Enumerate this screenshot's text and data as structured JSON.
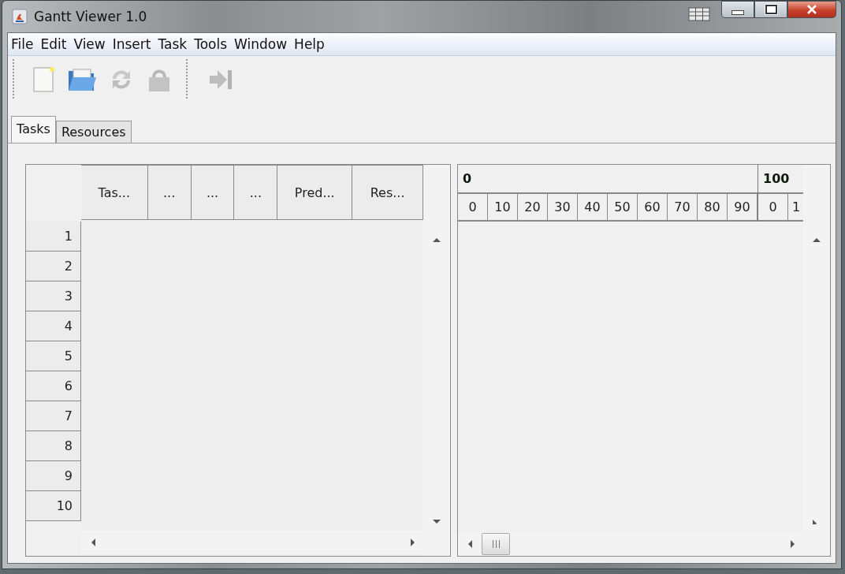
{
  "window": {
    "title": "Gantt Viewer 1.0"
  },
  "menu": [
    "File",
    "Edit",
    "View",
    "Insert",
    "Task",
    "Tools",
    "Window",
    "Help"
  ],
  "toolbar": [
    {
      "kind": "new",
      "disabled": false
    },
    {
      "kind": "open",
      "disabled": false
    },
    {
      "kind": "refresh",
      "disabled": true
    },
    {
      "kind": "save",
      "disabled": true
    },
    {
      "kind": "separator"
    },
    {
      "kind": "exit",
      "disabled": true
    }
  ],
  "tabs": [
    {
      "label": "Tasks",
      "selected": true
    },
    {
      "label": "Resources",
      "selected": false
    }
  ],
  "task_table": {
    "columns": [
      "Tas...",
      "...",
      "...",
      "...",
      "Pred...",
      "Res..."
    ],
    "row_numbers": [
      "1",
      "2",
      "3",
      "4",
      "5",
      "6",
      "7",
      "8",
      "9",
      "10"
    ]
  },
  "timeline": {
    "periods": [
      {
        "label": "0",
        "ticks": [
          "0",
          "10",
          "20",
          "30",
          "40",
          "50",
          "60",
          "70",
          "80",
          "90"
        ]
      },
      {
        "label": "100",
        "ticks": [
          "0",
          "1"
        ]
      }
    ]
  }
}
